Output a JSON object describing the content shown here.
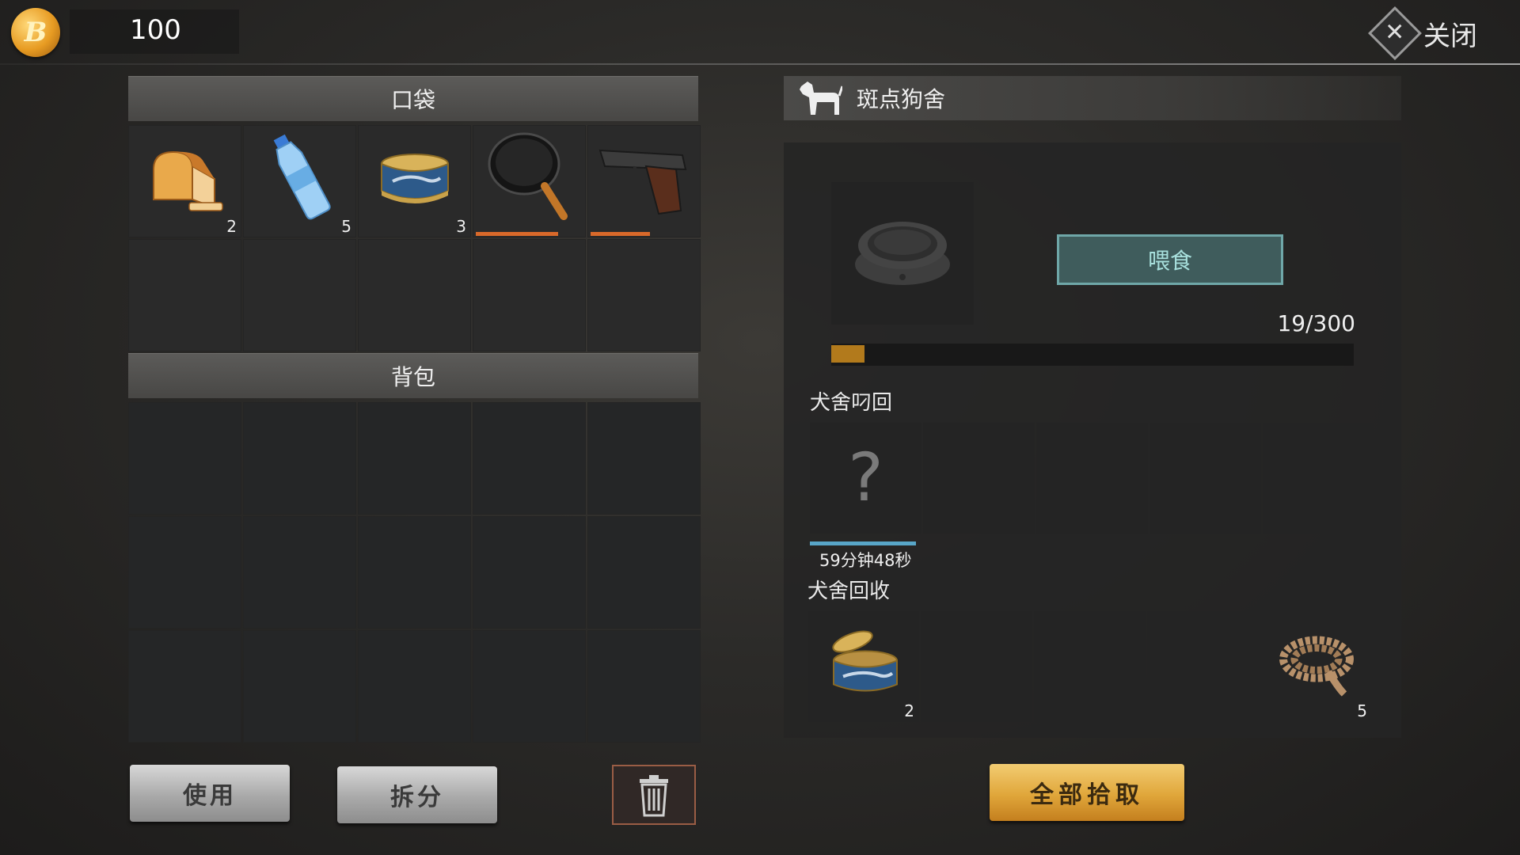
{
  "header": {
    "coin_icon": "coin-icon",
    "coin_letter": "B",
    "coin_amount": "100",
    "close_icon": "close-icon",
    "close_label": "关闭"
  },
  "pocket": {
    "title": "口袋",
    "slots": [
      {
        "item": "bread-icon",
        "qty": "2"
      },
      {
        "item": "water-bottle-icon",
        "qty": "5"
      },
      {
        "item": "canned-fish-icon",
        "qty": "3"
      },
      {
        "item": "frying-pan-icon",
        "durability": 0.93
      },
      {
        "item": "pistol-icon",
        "durability": 0.67
      }
    ]
  },
  "backpack": {
    "title": "背包"
  },
  "kennel": {
    "icon": "dog-icon",
    "title": "斑点狗舍",
    "feed_label": "喂食",
    "food_current": 19,
    "food_max": 300,
    "food_text": "19/300",
    "fetch_label": "犬舍叼回",
    "fetch_unknown": "?",
    "fetch_timer": "59分钟48秒",
    "fetch_timer_fraction": 0.95,
    "recycle_label": "犬舍回收",
    "recycle_slots": [
      {
        "item": "canned-fish-icon",
        "qty": "2"
      },
      {
        "item": "",
        "qty": ""
      },
      {
        "item": "",
        "qty": ""
      },
      {
        "item": "",
        "qty": ""
      },
      {
        "item": "rope-icon",
        "qty": "5"
      }
    ]
  },
  "buttons": {
    "use": "使用",
    "split": "拆分",
    "trash_icon": "trash-icon",
    "pickup_all": "全部拾取"
  }
}
